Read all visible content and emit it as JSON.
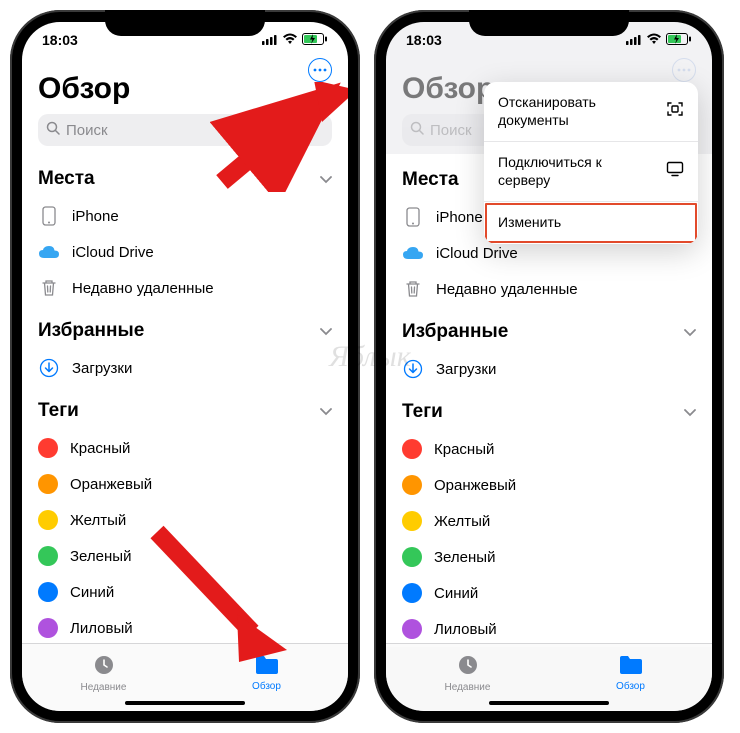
{
  "status": {
    "time": "18:03"
  },
  "page": {
    "title": "Обзор",
    "search_placeholder": "Поиск"
  },
  "sections": {
    "places": {
      "title": "Места",
      "items": [
        {
          "label": "iPhone"
        },
        {
          "label": "iCloud Drive"
        },
        {
          "label": "Недавно удаленные"
        }
      ]
    },
    "favorites": {
      "title": "Избранные",
      "items": [
        {
          "label": "Загрузки"
        }
      ]
    },
    "tags": {
      "title": "Теги",
      "items": [
        {
          "label": "Красный",
          "color": "#ff3b30"
        },
        {
          "label": "Оранжевый",
          "color": "#ff9500"
        },
        {
          "label": "Желтый",
          "color": "#ffcc00"
        },
        {
          "label": "Зеленый",
          "color": "#34c759"
        },
        {
          "label": "Синий",
          "color": "#007aff"
        },
        {
          "label": "Лиловый",
          "color": "#af52de"
        }
      ]
    }
  },
  "tabs": {
    "recents": "Недавние",
    "browse": "Обзор"
  },
  "popup": {
    "scan": "Отсканировать документы",
    "connect": "Подключиться к серверу",
    "edit": "Изменить"
  },
  "watermark": "Яблык"
}
